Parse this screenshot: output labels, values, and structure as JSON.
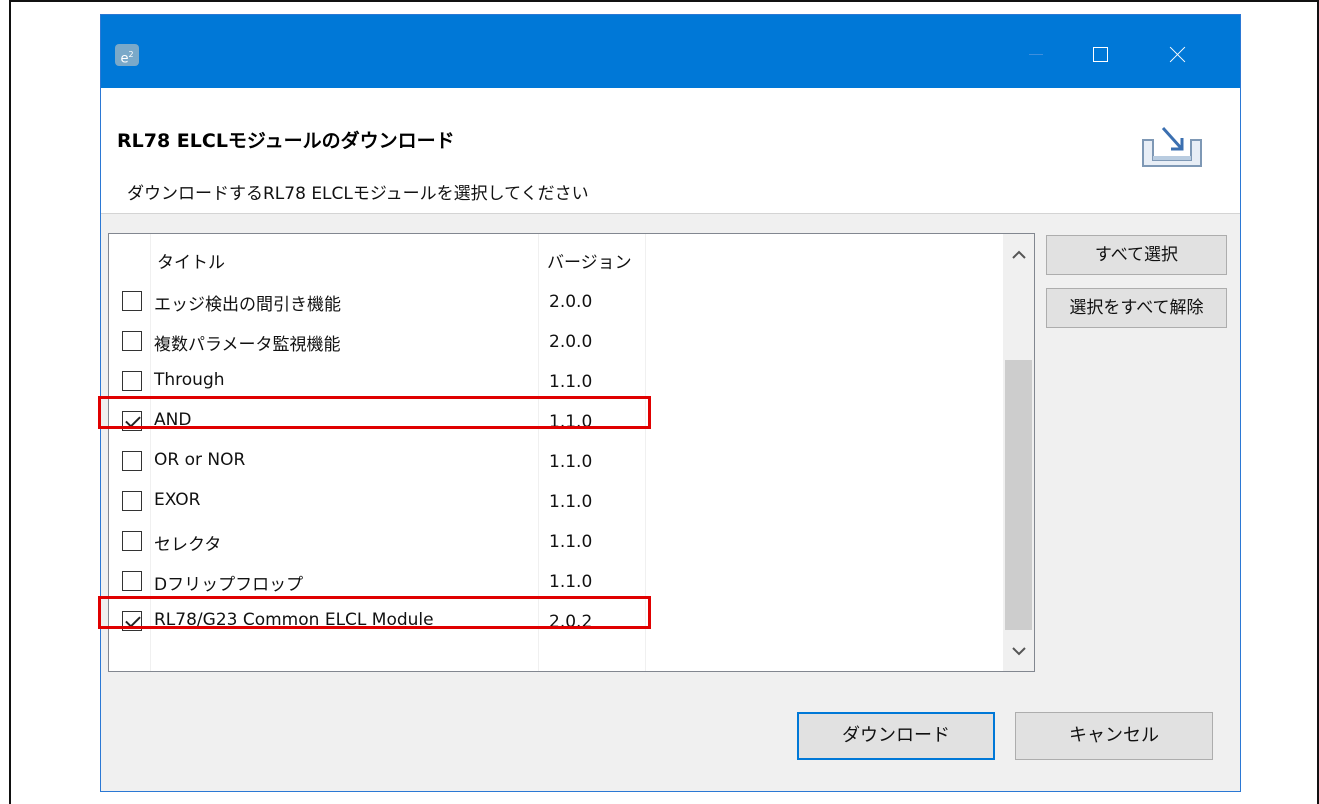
{
  "window": {
    "app_icon_text": "e",
    "app_icon_sup": "2"
  },
  "header": {
    "title": "RL78 ELCLモジュールのダウンロード",
    "subtitle": "ダウンロードするRL78 ELCLモジュールを選択してください",
    "icon": "download-tray-icon"
  },
  "table": {
    "columns": {
      "title": "タイトル",
      "version": "バージョン"
    },
    "rows": [
      {
        "title": "エッジ検出の間引き機能",
        "version": "2.0.0",
        "checked": false
      },
      {
        "title": "複数パラメータ監視機能",
        "version": "2.0.0",
        "checked": false
      },
      {
        "title": "Through",
        "version": "1.1.0",
        "checked": false
      },
      {
        "title": "AND",
        "version": "1.1.0",
        "checked": true
      },
      {
        "title": "OR or NOR",
        "version": "1.1.0",
        "checked": false
      },
      {
        "title": "EXOR",
        "version": "1.1.0",
        "checked": false
      },
      {
        "title": "セレクタ",
        "version": "1.1.0",
        "checked": false
      },
      {
        "title": "Dフリップフロップ",
        "version": "1.1.0",
        "checked": false
      },
      {
        "title": "RL78/G23 Common ELCL Module",
        "version": "2.0.2",
        "checked": true
      }
    ],
    "scroll_up_glyph": "^",
    "scroll_down_glyph": "v"
  },
  "buttons": {
    "select_all": "すべて選択",
    "deselect_all": "選択をすべて解除",
    "download": "ダウンロード",
    "cancel": "キャンセル"
  },
  "colors": {
    "titlebar": "#0078d7",
    "highlight": "#e00000"
  }
}
